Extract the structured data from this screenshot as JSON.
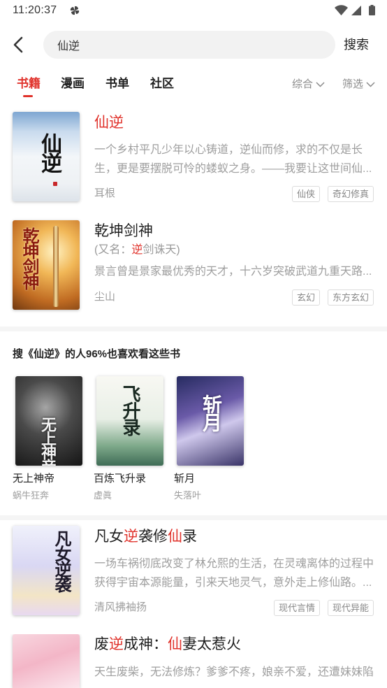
{
  "status_bar": {
    "time": "11:20:37",
    "icons": [
      "pinwheel-icon",
      "wifi-icon",
      "signal-icon",
      "battery-icon"
    ]
  },
  "search": {
    "back_icon": "chevron-left-icon",
    "value": "仙逆",
    "button_label": "搜索"
  },
  "tabs": [
    {
      "label": "书籍",
      "active": true
    },
    {
      "label": "漫画",
      "active": false
    },
    {
      "label": "书单",
      "active": false
    },
    {
      "label": "社区",
      "active": false
    }
  ],
  "sort": {
    "label": "综合",
    "icon": "chevron-down-icon"
  },
  "filter": {
    "label": "筛选",
    "icon": "chevron-down-icon"
  },
  "colors": {
    "accent": "#e0322b",
    "text": "#222222",
    "muted": "#9e9e9e"
  },
  "results": [
    {
      "cover_text": "仙逆",
      "title_parts": [
        {
          "text": "仙逆",
          "highlight": true
        }
      ],
      "description": "一个乡村平凡少年以心铸道，逆仙而修，求的不仅是长生，更是要摆脱可怜的蝼蚁之身。——我要让这世间仙...",
      "author": "耳根",
      "tags": [
        "仙侠",
        "奇幻修真"
      ]
    },
    {
      "cover_text": "乾坤剑神",
      "title_parts": [
        {
          "text": "乾坤剑神",
          "highlight": false
        }
      ],
      "alias_parts": [
        {
          "text": "(又名：",
          "highlight": false
        },
        {
          "text": "逆",
          "highlight": true
        },
        {
          "text": "剑诛天)",
          "highlight": false
        }
      ],
      "description": "景言曾是景家最优秀的天才，十六岁突破武道九重天路...",
      "author": "尘山",
      "tags": [
        "玄幻",
        "东方玄幻"
      ]
    }
  ],
  "recommendations": {
    "heading": "搜《仙逆》的人96%也喜欢看这些书",
    "books": [
      {
        "cover_text": "无上神帝",
        "title": "无上神帝",
        "author": "蜗牛狂奔"
      },
      {
        "cover_text": "飞升录",
        "title": "百炼飞升录",
        "author": "虚眞"
      },
      {
        "cover_text": "斩月",
        "title": "斩月",
        "author": "失落叶"
      }
    ]
  },
  "more_results": [
    {
      "cover_text": "凡女逆袭",
      "title_parts": [
        {
          "text": "凡女",
          "highlight": false
        },
        {
          "text": "逆",
          "highlight": true
        },
        {
          "text": "袭修",
          "highlight": false
        },
        {
          "text": "仙",
          "highlight": true
        },
        {
          "text": "录",
          "highlight": false
        }
      ],
      "description": "一场车祸彻底改变了林允熙的生活，在灵魂离体的过程中获得宇宙本源能量，引来天地灵气，意外走上修仙路。...",
      "author": "清风拂袖扬",
      "tags": [
        "现代言情",
        "现代异能"
      ]
    },
    {
      "title_parts": [
        {
          "text": "废",
          "highlight": false
        },
        {
          "text": "逆",
          "highlight": true
        },
        {
          "text": "成神：",
          "highlight": false
        },
        {
          "text": "仙",
          "highlight": true
        },
        {
          "text": "妻太惹火",
          "highlight": false
        }
      ],
      "description": "天生废柴，无法修炼？爹爹不疼，娘亲不爱，还遭妹妹陷"
    }
  ]
}
